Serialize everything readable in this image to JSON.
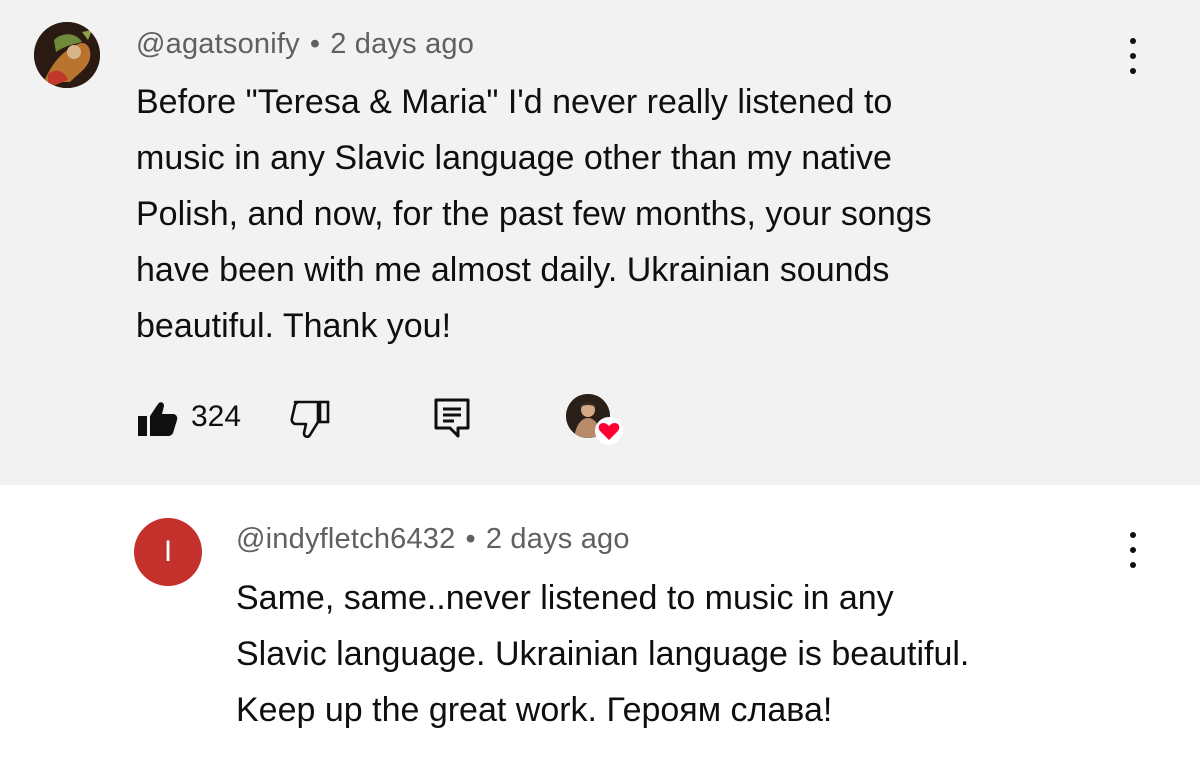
{
  "comments": [
    {
      "handle": "@agatsonify",
      "separator": "•",
      "time": "2 days ago",
      "body_lines": [
        "Before \"Teresa & Maria\" I'd never really listened to",
        "music in any Slavic language other than my native",
        "Polish, and now, for the past few months, your songs",
        "have been with me almost daily. Ukrainian sounds",
        "beautiful. Thank you!"
      ],
      "like_count": "324",
      "avatar_icon": "profile-photo",
      "highlighted": true
    },
    {
      "handle": "@indyfletch6432",
      "separator": "•",
      "time": "2 days ago",
      "avatar_letter": "I",
      "avatar_color": "#c4302b",
      "body_lines": [
        "Same, same..never listened to music in any",
        "Slavic language. Ukrainian language is beautiful.",
        "Keep up the great work. Героям слава!"
      ]
    }
  ],
  "icons": {
    "like": "thumbs-up-filled-icon",
    "dislike": "thumbs-down-outline-icon",
    "reply": "comment-reply-icon",
    "more": "vertical-ellipsis-icon",
    "creator_heart": "creator-heart-icon"
  },
  "colors": {
    "highlight_bg": "#f2f2f2",
    "meta_text": "#606060",
    "heart": "#ff0033"
  }
}
